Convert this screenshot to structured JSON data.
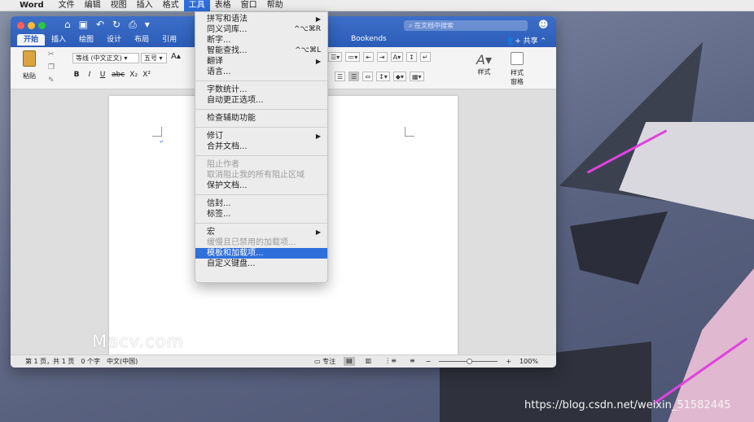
{
  "menubar": {
    "app_name": "Word",
    "items": [
      "文件",
      "编辑",
      "视图",
      "插入",
      "格式",
      "工具",
      "表格",
      "窗口",
      "帮助"
    ],
    "active": "工具"
  },
  "window": {
    "search_placeholder": "在文档中搜索",
    "tabs": [
      "开始",
      "插入",
      "绘图",
      "设计",
      "布局",
      "引用"
    ],
    "bookends": "Bookends",
    "share": "共享",
    "ribbon": {
      "paste": "粘贴",
      "font": "等线 (中文正文)",
      "size": "五号",
      "grow": "A",
      "format_buttons": [
        "B",
        "I",
        "U",
        "abc",
        "X₂",
        "X²"
      ],
      "styles": "样式",
      "style_pane": "样式\n窗格"
    }
  },
  "tools_menu": {
    "groups": [
      [
        {
          "label": "拼写和语法",
          "submenu": true
        },
        {
          "label": "同义词库...",
          "shortcut": "^⌥⌘R"
        },
        {
          "label": "断字..."
        },
        {
          "label": "智能查找...",
          "shortcut": "^⌥⌘L"
        },
        {
          "label": "翻译",
          "submenu": true
        },
        {
          "label": "语言..."
        }
      ],
      [
        {
          "label": "字数统计..."
        },
        {
          "label": "自动更正选项..."
        }
      ],
      [
        {
          "label": "检查辅助功能"
        }
      ],
      [
        {
          "label": "修订",
          "submenu": true
        },
        {
          "label": "合并文档..."
        }
      ],
      [
        {
          "label": "阻止作者",
          "disabled": true
        },
        {
          "label": "取消阻止我的所有阻止区域",
          "disabled": true
        },
        {
          "label": "保护文档..."
        }
      ],
      [
        {
          "label": "信封..."
        },
        {
          "label": "标签..."
        }
      ],
      [
        {
          "label": "宏",
          "submenu": true
        },
        {
          "label": "缓慢且已禁用的加载项...",
          "disabled": true
        },
        {
          "label": "模板和加载项...",
          "highlighted": true
        },
        {
          "label": "自定义键盘..."
        }
      ]
    ]
  },
  "statusbar": {
    "page_info": "第 1 页，共 1 页",
    "word_count": "0 个字",
    "language": "中文(中国)",
    "focus": "专注",
    "zoom": "100%"
  },
  "watermarks": {
    "macv": "Macv.com",
    "csdn": "https://blog.csdn.net/weixin_51582445"
  },
  "colors": {
    "accent": "#2e6fdb",
    "title_bar": "#2b5cb8"
  }
}
